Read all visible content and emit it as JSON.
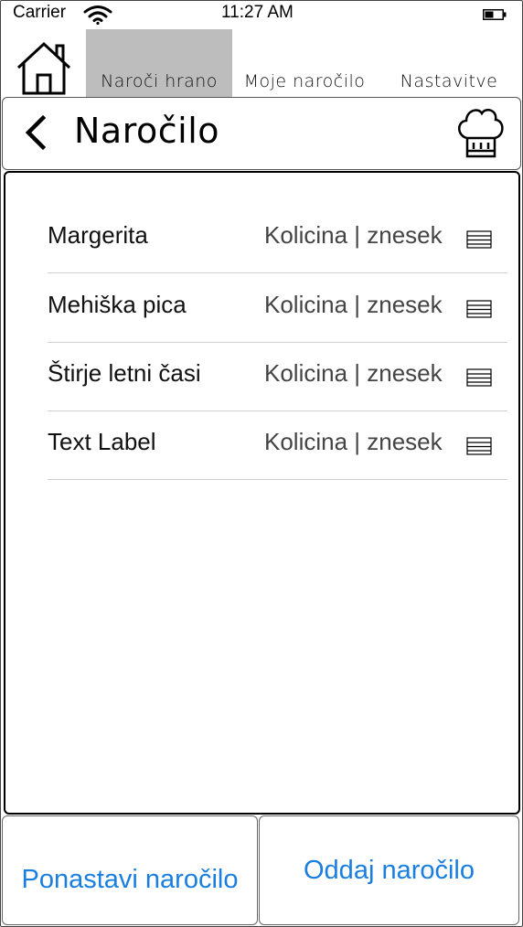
{
  "status_bar": {
    "carrier": "Carrier",
    "time": "11:27 AM",
    "wifi_icon": "wifi-icon",
    "battery_icon": "battery-icon"
  },
  "tab_bar": {
    "home_icon": "home-icon",
    "tabs": [
      {
        "label": "Naroči hrano",
        "active": true
      },
      {
        "label": "Moje naročilo",
        "active": false
      },
      {
        "label": "Nastavitve",
        "active": false
      }
    ],
    "active_color": "#bdbdbd"
  },
  "header": {
    "back_icon": "chevron-left-icon",
    "title": "Naročilo",
    "chef_icon": "chef-hat-icon"
  },
  "order_list": {
    "items": [
      {
        "name": "Margerita",
        "detail": "Kolicina | znesek"
      },
      {
        "name": "Mehiška pica",
        "detail": "Kolicina | znesek"
      },
      {
        "name": "Štirje letni časi",
        "detail": "Kolicina | znesek"
      },
      {
        "name": "Text Label",
        "detail": "Kolicina | znesek"
      }
    ],
    "handle_icon": "reorder-icon"
  },
  "actions": {
    "reset_label": "Ponastavi naročilo",
    "submit_label": "Oddaj naročilo",
    "accent_color": "#1a7ee0"
  }
}
